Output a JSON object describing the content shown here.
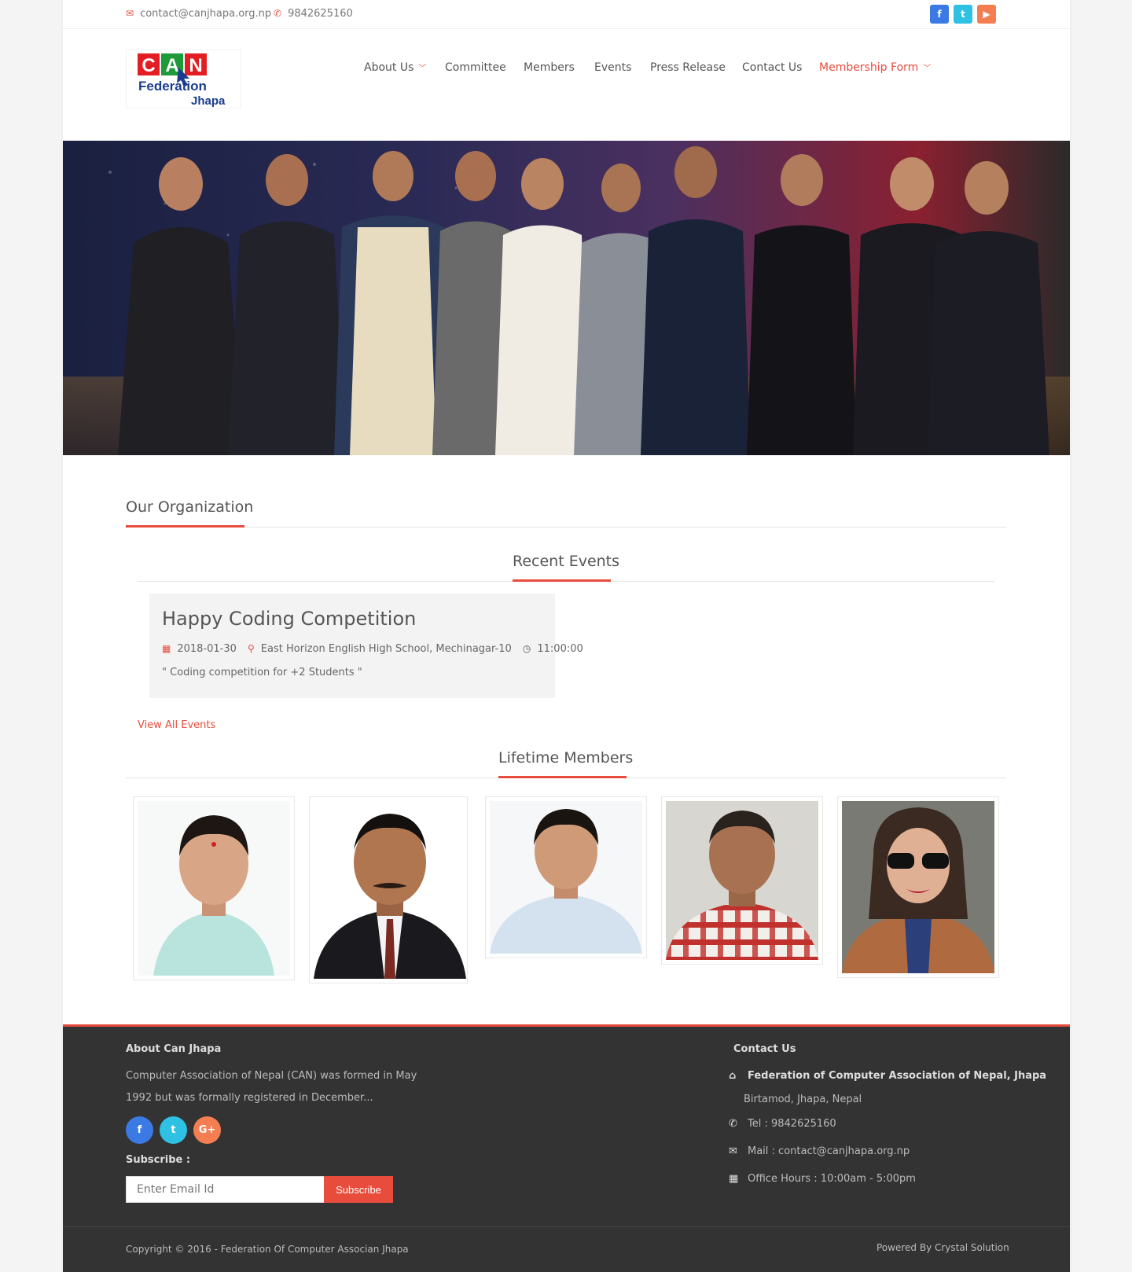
{
  "topbar": {
    "email": "contact@canjhapa.org.np",
    "phone": "9842625160",
    "email_icon": "envelope-icon",
    "phone_icon": "phone-icon",
    "social": [
      "facebook-icon",
      "twitter-icon",
      "youtube-icon"
    ]
  },
  "logo": {
    "line1": "CAN",
    "line2": "Federation",
    "line3": "Jhapa"
  },
  "nav": [
    {
      "label": "About Us",
      "dropdown": true
    },
    {
      "label": "Committee"
    },
    {
      "label": "Members"
    },
    {
      "label": "Events"
    },
    {
      "label": "Press Release"
    },
    {
      "label": "Contact Us"
    },
    {
      "label": "Membership Form",
      "dropdown": true,
      "active": true
    }
  ],
  "sections": {
    "organization": "Our Organization",
    "recent_events": "Recent Events",
    "lifetime_members": "Lifetime Members"
  },
  "event": {
    "title": "Happy Coding Competition",
    "date": "2018-01-30",
    "location": "East Horizon English High School, Mechinagar-10",
    "time": "11:00:00",
    "description": "\" Coding competition for +2 Students \""
  },
  "view_all_events": "View All Events",
  "footer": {
    "about_heading": "About Can Jhapa",
    "about_line1": "Computer Association of Nepal (CAN) was formed in May",
    "about_line2": "1992 but was formally registered in December...",
    "social": [
      "f",
      "t",
      "G+"
    ],
    "subscribe_label": "Subscribe :",
    "subscribe_placeholder": "Enter Email Id",
    "subscribe_button": "Subscribe",
    "contact_heading": "Contact Us",
    "org_name": "Federation of Computer Association of Nepal, Jhapa",
    "address": "Birtamod, Jhapa, Nepal",
    "tel": "Tel :   9842625160",
    "mail": "Mail : contact@canjhapa.org.np",
    "hours": "Office Hours : 10:00am - 5:00pm",
    "copyright": "Copyright © 2016 - Federation Of Computer Associan Jhapa",
    "powered": "Powered By Crystal Solution"
  },
  "colors": {
    "accent": "#e84c3d",
    "footer_bg": "#333333",
    "facebook": "#3b79e4",
    "twitter": "#2fc1e4",
    "youtube": "#f47e52"
  }
}
